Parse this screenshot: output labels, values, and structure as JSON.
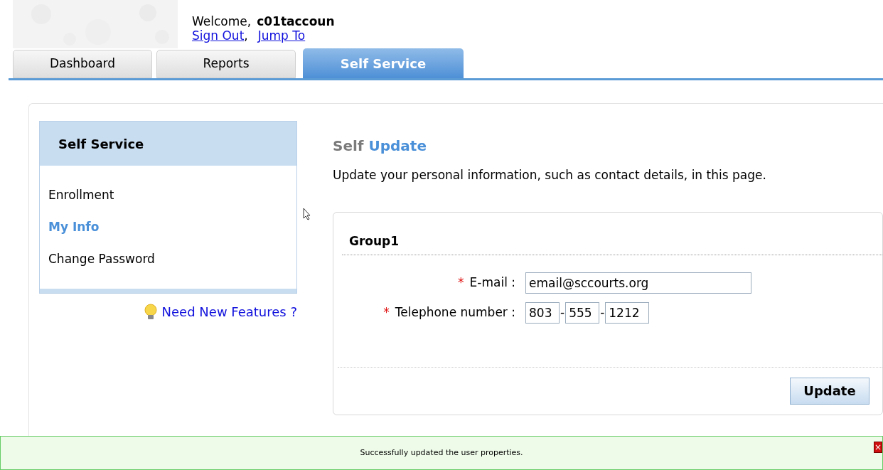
{
  "header": {
    "welcome": "Welcome,",
    "username": "c01taccoun",
    "links": [
      {
        "label": "Sign Out",
        "separator": ","
      },
      {
        "label": "Jump To"
      }
    ]
  },
  "tabs": [
    {
      "label": "Dashboard",
      "selected": false
    },
    {
      "label": "Reports",
      "selected": false
    },
    {
      "label": "Self Service",
      "selected": true
    }
  ],
  "sidebar": {
    "title": "Self Service",
    "items": [
      {
        "label": "Enrollment",
        "selected": false
      },
      {
        "label": "My Info",
        "selected": true
      },
      {
        "label": "Change Password",
        "selected": false
      }
    ],
    "feature_link": "Need New Features ?"
  },
  "main": {
    "title_first": "Self",
    "title_second": "Update",
    "description": "Update your personal information, such as contact details, in this page.",
    "group": {
      "title": "Group1",
      "fields": [
        {
          "kind": "text",
          "label": "E-mail :",
          "required": true,
          "required_mark": "*",
          "value": "email@sccourts.org"
        },
        {
          "kind": "phone",
          "label": "Telephone number :",
          "required": true,
          "required_mark": "*",
          "parts": [
            "803",
            "555",
            "1212"
          ],
          "separators": [
            "-",
            "-"
          ]
        }
      ]
    },
    "button": "Update"
  },
  "message": {
    "text": "Successfully updated the user properties.",
    "close": "×"
  }
}
